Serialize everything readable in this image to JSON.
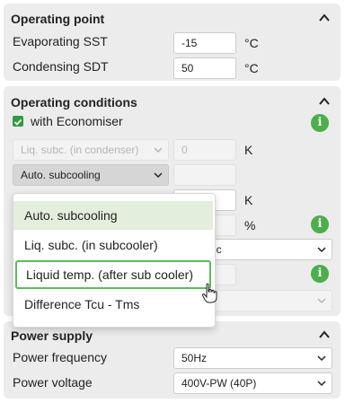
{
  "operating_point": {
    "title": "Operating point",
    "evaporating_label": "Evaporating SST",
    "evaporating_value": "-15",
    "evaporating_unit": "°C",
    "condensing_label": "Condensing SDT",
    "condensing_value": "50",
    "condensing_unit": "°C"
  },
  "operating_conditions": {
    "title": "Operating conditions",
    "economiser_label": "with Economiser",
    "economiser_checked": true,
    "liq_subc_select": "Liq. subc. (in condenser)",
    "liq_subc_value": "0",
    "liq_subc_unit": "K",
    "subcooling_select": "Auto. subcooling",
    "unit_k": "K",
    "unit_percent": "%",
    "partial_select_text": "atic",
    "info_icon": "i"
  },
  "dropdown": {
    "options": [
      "Auto. subcooling",
      "Liq. subc. (in subcooler)",
      "Liquid temp. (after sub cooler)",
      "Difference Tcu - Tms"
    ],
    "selected_index": 0,
    "hover_index": 2
  },
  "power_supply": {
    "title": "Power supply",
    "frequency_label": "Power frequency",
    "frequency_value": "50Hz",
    "voltage_label": "Power voltage",
    "voltage_value": "400V-PW (40P)"
  },
  "colors": {
    "accent_green": "#4cae4c",
    "panel_bg": "#ececec"
  }
}
